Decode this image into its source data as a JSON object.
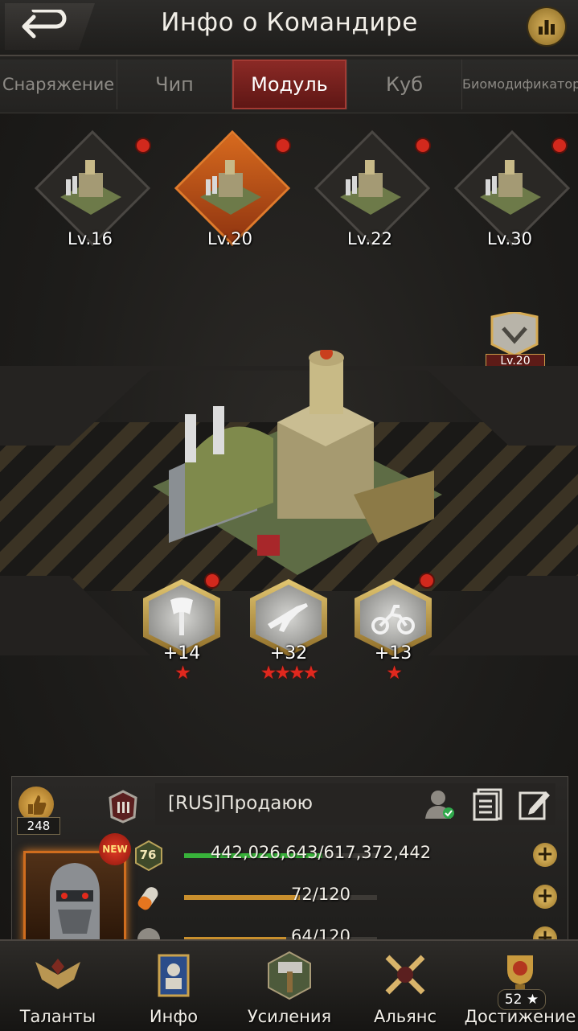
{
  "header": {
    "title": "Инфо о Командире"
  },
  "tabs": [
    {
      "label": "Снаряжение",
      "active": false
    },
    {
      "label": "Чип",
      "active": false
    },
    {
      "label": "Модуль",
      "active": true
    },
    {
      "label": "Куб",
      "active": false
    },
    {
      "label": "Биомодификатор",
      "active": false
    }
  ],
  "modules": [
    {
      "level": "Lv.16",
      "selected": false,
      "notification": true
    },
    {
      "level": "Lv.20",
      "selected": true,
      "notification": true
    },
    {
      "level": "Lv.22",
      "selected": false,
      "notification": true
    },
    {
      "level": "Lv.30",
      "selected": false,
      "notification": true
    }
  ],
  "module_badge": {
    "level": "Lv.20"
  },
  "skills": [
    {
      "icon": "axe-icon",
      "bonus": "+14",
      "stars": 1,
      "notification": true
    },
    {
      "icon": "rifle-icon",
      "bonus": "+32",
      "stars": 4,
      "notification": false
    },
    {
      "icon": "motorcycle-icon",
      "bonus": "+13",
      "stars": 1,
      "notification": true
    }
  ],
  "profile": {
    "likes": "248",
    "name": "[RUS]Продаюю",
    "commander_level": "76",
    "bars": [
      {
        "icon": "level-icon",
        "text": "442,026,643/617,372,442",
        "fill": 0.716,
        "color": "#38b23a"
      },
      {
        "icon": "stamina-icon",
        "text": "72/120",
        "fill": 0.6,
        "color": "#c98f2d"
      },
      {
        "icon": "energy-icon",
        "text": "64/120",
        "fill": 0.53,
        "color": "#c98f2d"
      }
    ],
    "new_badge": "NEW"
  },
  "bottom_nav": [
    {
      "label": "Таланты"
    },
    {
      "label": "Инфо"
    },
    {
      "label": "Усиления"
    },
    {
      "label": "Альянс"
    },
    {
      "label": "Достижение",
      "count": "52 ★"
    }
  ],
  "colors": {
    "accent_red": "#8c2a26",
    "gold": "#d9b25c",
    "notification": "#d2291d"
  }
}
